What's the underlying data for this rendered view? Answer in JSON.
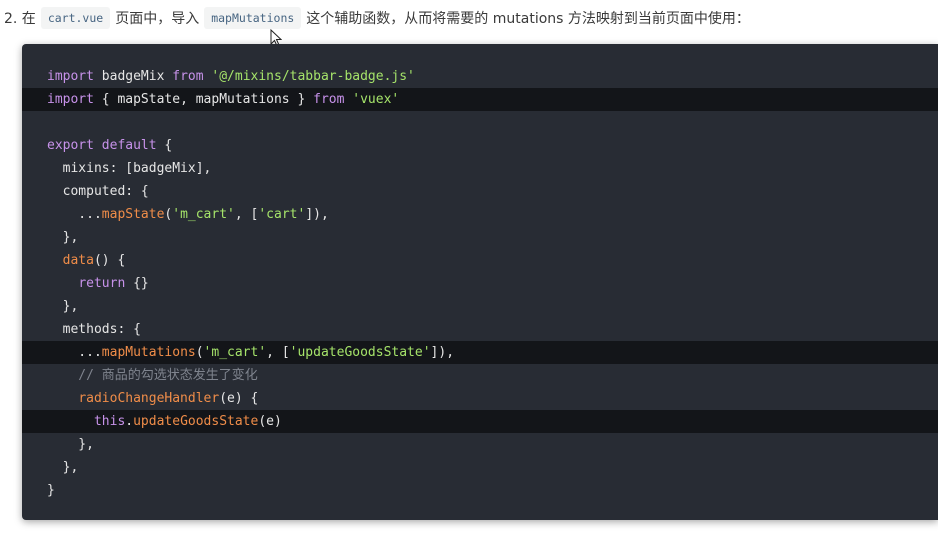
{
  "intro": {
    "number": "2. 在",
    "file_code": "cart.vue",
    "text_mid": "页面中，导入",
    "helper_code": "mapMutations",
    "text_end": "这个辅助函数，从而将需要的 mutations 方法映射到当前页面中使用："
  },
  "code": {
    "lines": [
      {
        "tokens": [
          {
            "t": "import ",
            "c": "kw"
          },
          {
            "t": "badgeMix ",
            "c": "pl"
          },
          {
            "t": "from ",
            "c": "kw"
          },
          {
            "t": "'@/mixins/tabbar-badge.js'",
            "c": "str"
          }
        ]
      },
      {
        "tokens": [
          {
            "t": "import ",
            "c": "kw"
          },
          {
            "t": "{ mapState, mapMutations } ",
            "c": "pl"
          },
          {
            "t": "from ",
            "c": "kw"
          },
          {
            "t": "'vuex'",
            "c": "str"
          }
        ],
        "highlight": true
      },
      {
        "tokens": []
      },
      {
        "tokens": [
          {
            "t": "export default ",
            "c": "kw"
          },
          {
            "t": "{",
            "c": "pl"
          }
        ]
      },
      {
        "tokens": [
          {
            "t": "  mixins: [badgeMix],",
            "c": "pl"
          }
        ]
      },
      {
        "tokens": [
          {
            "t": "  computed: {",
            "c": "pl"
          }
        ]
      },
      {
        "tokens": [
          {
            "t": "    ...",
            "c": "pl"
          },
          {
            "t": "mapState",
            "c": "fn"
          },
          {
            "t": "(",
            "c": "pl"
          },
          {
            "t": "'m_cart'",
            "c": "str"
          },
          {
            "t": ", [",
            "c": "pl"
          },
          {
            "t": "'cart'",
            "c": "str"
          },
          {
            "t": "]),",
            "c": "pl"
          }
        ]
      },
      {
        "tokens": [
          {
            "t": "  },",
            "c": "pl"
          }
        ]
      },
      {
        "tokens": [
          {
            "t": "  ",
            "c": "pl"
          },
          {
            "t": "data",
            "c": "fn"
          },
          {
            "t": "() {",
            "c": "pl"
          }
        ]
      },
      {
        "tokens": [
          {
            "t": "    ",
            "c": "pl"
          },
          {
            "t": "return ",
            "c": "kw"
          },
          {
            "t": "{}",
            "c": "pl"
          }
        ]
      },
      {
        "tokens": [
          {
            "t": "  },",
            "c": "pl"
          }
        ]
      },
      {
        "tokens": [
          {
            "t": "  methods: {",
            "c": "pl"
          }
        ]
      },
      {
        "tokens": [
          {
            "t": "    ...",
            "c": "pl"
          },
          {
            "t": "mapMutations",
            "c": "fn"
          },
          {
            "t": "(",
            "c": "pl"
          },
          {
            "t": "'m_cart'",
            "c": "str"
          },
          {
            "t": ", [",
            "c": "pl"
          },
          {
            "t": "'updateGoodsState'",
            "c": "str"
          },
          {
            "t": "]),",
            "c": "pl"
          }
        ],
        "highlight": true
      },
      {
        "tokens": [
          {
            "t": "    // 商品的勾选状态发生了变化",
            "c": "cmt"
          }
        ]
      },
      {
        "tokens": [
          {
            "t": "    ",
            "c": "pl"
          },
          {
            "t": "radioChangeHandler",
            "c": "fn"
          },
          {
            "t": "(e) {",
            "c": "pl"
          }
        ]
      },
      {
        "tokens": [
          {
            "t": "      ",
            "c": "pl"
          },
          {
            "t": "this",
            "c": "kw"
          },
          {
            "t": ".",
            "c": "pl"
          },
          {
            "t": "updateGoodsState",
            "c": "fn"
          },
          {
            "t": "(e)",
            "c": "pl"
          }
        ],
        "highlight": true
      },
      {
        "tokens": [
          {
            "t": "    },",
            "c": "pl"
          }
        ]
      },
      {
        "tokens": [
          {
            "t": "  },",
            "c": "pl"
          }
        ]
      },
      {
        "tokens": [
          {
            "t": "}",
            "c": "pl"
          }
        ]
      }
    ]
  },
  "colors": {
    "code_background": "#282c34",
    "highlight_background": "#131519",
    "keyword": "#c792ea",
    "string": "#a5e36a",
    "function": "#f08d49",
    "comment": "#7f848e"
  },
  "cursor_icon": "arrow-cursor-icon"
}
